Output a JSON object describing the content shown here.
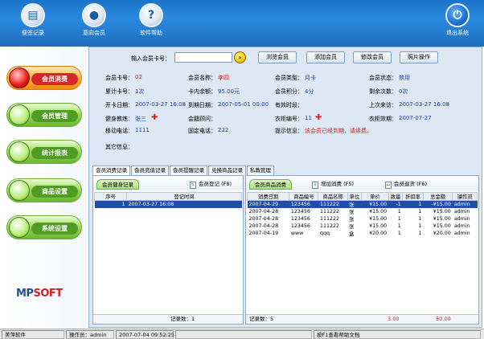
{
  "toolbar": {
    "items": [
      {
        "label": "便签记录",
        "icon": "notepad-icon"
      },
      {
        "label": "意向会员",
        "icon": "member-icon"
      },
      {
        "label": "软件帮助",
        "icon": "help-icon"
      },
      {
        "label": "退出系统",
        "icon": "power-icon"
      }
    ]
  },
  "sidebar": {
    "items": [
      {
        "label": "会员消费"
      },
      {
        "label": "会员管理"
      },
      {
        "label": "统计报表"
      },
      {
        "label": "商品设置"
      },
      {
        "label": "系统设置"
      }
    ],
    "logo_a": "MP",
    "logo_b": "SOFT"
  },
  "search": {
    "label": "输入会员卡号：",
    "value": "",
    "buttons": [
      "浏览会员",
      "添加会员",
      "修改会员",
      "照片操作"
    ]
  },
  "member": {
    "card_no_label": "会员卡号：",
    "card_no": "02",
    "name_label": "会员名称：",
    "name": "李四",
    "type_label": "会员类型：",
    "type": "月卡",
    "status_label": "会员状态：",
    "status": "禁用",
    "total_label": "累计卡号：",
    "total": "1次",
    "balance_label": "卡内余额：",
    "balance": "95.00元",
    "points_label": "会员积分：",
    "points": "4分",
    "remaining_label": "剩余次数：",
    "remaining": "0次",
    "open_label": "开卡日期：",
    "open": "2007-03-27 16:08",
    "expire_label": "到期日期：",
    "expire": "2007-05-01 00:00",
    "valid_label": "有效时段：",
    "valid": "",
    "last_label": "上次来访：",
    "last": "2007-03-27 16:08",
    "coach_label": "健身教练：",
    "coach": "张三",
    "locker_label": "会籍顾问：",
    "locker": "",
    "cabinet_label": "衣柜编号：",
    "cabinet": "11",
    "cabinet_exp_label": "衣柜效期：",
    "cabinet_exp": "2007-07-27",
    "mobile_label": "移动电话：",
    "mobile": "1111",
    "phone_label": "固定电话：",
    "phone": "222",
    "tip_label": "提示信息：",
    "tip": "该会员已经到期，请续费。",
    "other_label": "其它信息："
  },
  "tabs": [
    "会员消费记录",
    "会员充值记录",
    "会员提醒记录",
    "兑换商品记录",
    "私教管理"
  ],
  "left_pane": {
    "title": "会员健身记录",
    "button": "会员登记 (F8)",
    "columns": [
      "序号",
      "登记时间"
    ],
    "rows": [
      [
        "1",
        "2007-03-27 16:08"
      ]
    ],
    "footer": "记录数：1"
  },
  "right_pane": {
    "title": "会员商品消费",
    "button_add": "增加消费 (F5)",
    "button_return": "会员退货 (F6)",
    "columns": [
      "消费日期",
      "商品编号",
      "商品名称",
      "单位",
      "单价",
      "数量",
      "折扣率",
      "总金额",
      "操作员"
    ],
    "rows": [
      [
        "2007-04-29",
        "123456",
        "111222",
        "张",
        "¥15.00",
        "-1",
        "1",
        "-¥15.00",
        "admin"
      ],
      [
        "2007-04-28",
        "123456",
        "111222",
        "张",
        "¥15.00",
        "1",
        "1",
        "¥15.00",
        "admin"
      ],
      [
        "2007-04-28",
        "123456",
        "111222",
        "张",
        "¥15.00",
        "1",
        "1",
        "¥15.00",
        "admin"
      ],
      [
        "2007-04-28",
        "123456",
        "111222",
        "张",
        "¥15.00",
        "1",
        "1",
        "¥15.00",
        "admin"
      ],
      [
        "2007-04-19",
        "www",
        "qqq",
        "盒",
        "¥20.00",
        "1",
        "1",
        "¥20.00",
        "admin"
      ]
    ],
    "footer_count": "记录数：5",
    "footer_qty": "3.00",
    "footer_amount": "50.00"
  },
  "status": {
    "company": "美萍软件",
    "operator": "操作员：admin",
    "datetime": "2007-07-04 09:52:25",
    "help": "按F1查看帮助文档"
  }
}
